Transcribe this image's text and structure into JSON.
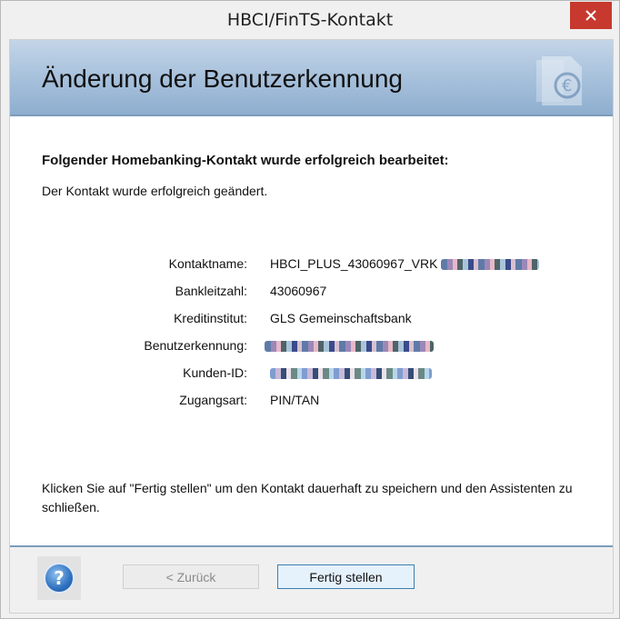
{
  "window": {
    "title": "HBCI/FinTS-Kontakt"
  },
  "banner": {
    "title": "Änderung der Benutzerkennung"
  },
  "main": {
    "heading": "Folgender Homebanking-Kontakt wurde erfolgreich bearbeitet:",
    "description": "Der Kontakt wurde erfolgreich geändert.",
    "fields": [
      {
        "label": "Kontaktname:",
        "value": "HBCI_PLUS_43060967_VRK"
      },
      {
        "label": "Bankleitzahl:",
        "value": "43060967"
      },
      {
        "label": "Kreditinstitut:",
        "value": "GLS Gemeinschaftsbank"
      },
      {
        "label": "Benutzerkennung:",
        "value": ""
      },
      {
        "label": "Kunden-ID:",
        "value": ""
      },
      {
        "label": "Zugangsart:",
        "value": "PIN/TAN"
      }
    ],
    "footer_text": "Klicken Sie auf \"Fertig stellen\" um den Kontakt dauerhaft zu speichern und den Assistenten zu schließen."
  },
  "buttons": {
    "back_label": "< Zurück",
    "finish_label": "Fertig stellen",
    "help_label": "?"
  },
  "icons": {
    "close": "close-icon",
    "help": "help-icon",
    "logo": "euro-document-icon"
  },
  "colors": {
    "close_button": "#c7392f",
    "banner": "#aac3dd",
    "accent": "#3c7fb1"
  }
}
